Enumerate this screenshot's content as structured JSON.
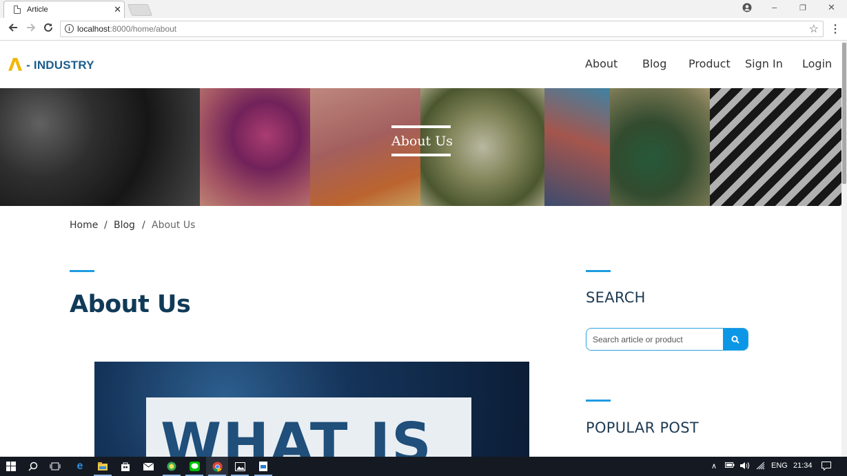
{
  "browser": {
    "tab_title": "Article",
    "tab_close": "✕",
    "url_host": "localhost",
    "url_rest": ":8000/home/about",
    "win_controls": {
      "minimize": "–",
      "restore": "❐",
      "close": "✕"
    }
  },
  "site": {
    "logo_mark": "Λ",
    "logo_text": "- INDUSTRY",
    "nav": [
      "About",
      "Blog",
      "Product",
      "Sign In",
      "Login"
    ],
    "hero_title": "About Us",
    "breadcrumb": {
      "home": "Home",
      "sep": "/",
      "blog": "Blog",
      "current": "About Us"
    },
    "page_title": "About Us",
    "article_image_text": "WHAT IS",
    "sidebar": {
      "search_heading": "SEARCH",
      "search_placeholder": "Search article or product",
      "popular_heading": "POPULAR POST"
    },
    "colors": {
      "accent": "#1e9be0",
      "title": "#103a57",
      "logo": "#1b5d8c",
      "logo_mark": "#f2b705",
      "search_button": "#0b97e6"
    }
  },
  "taskbar": {
    "tray_lang": "ENG",
    "tray_time": "21:34"
  }
}
